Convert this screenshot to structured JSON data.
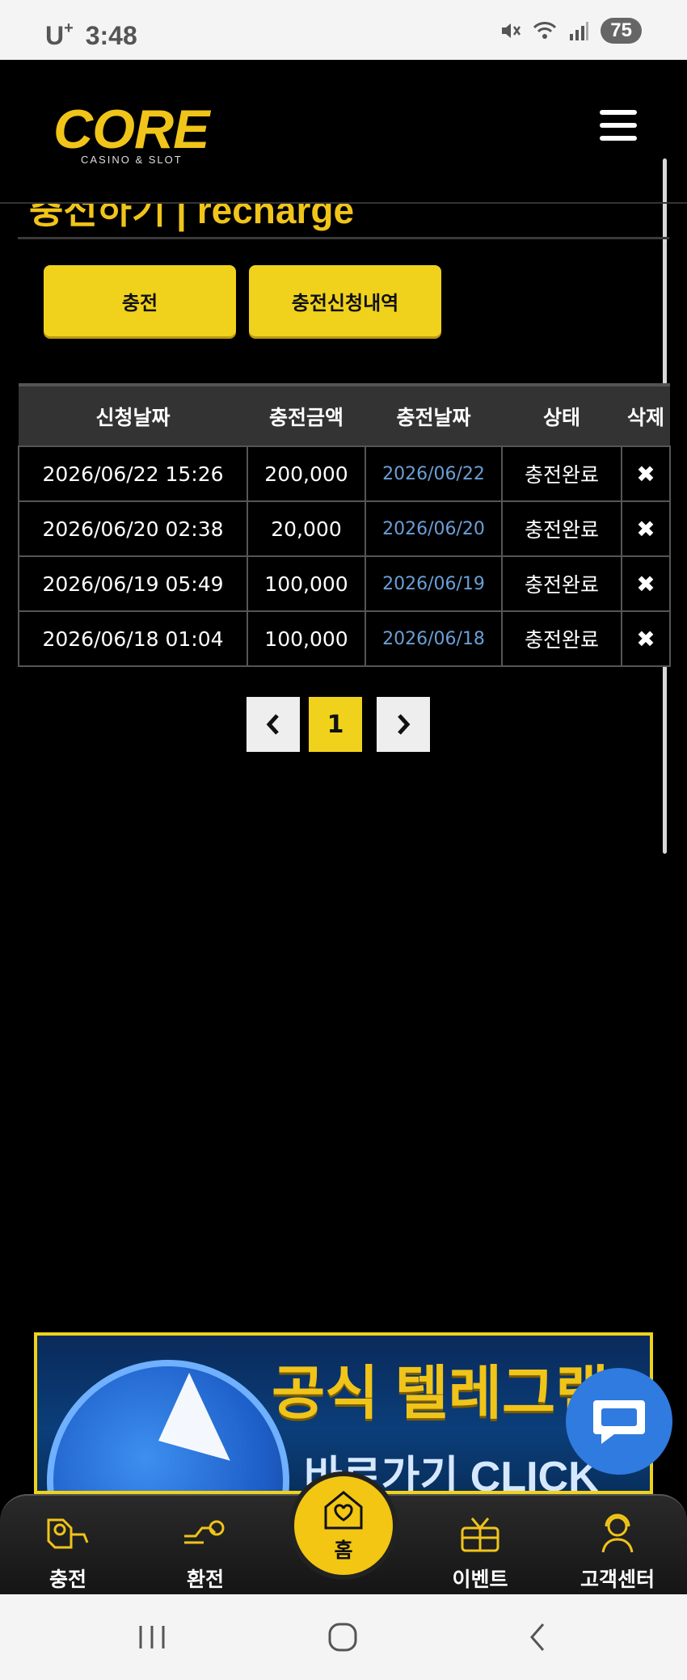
{
  "status_bar": {
    "carrier": "U",
    "carrier_sup": "+",
    "time": "3:48",
    "battery": "75"
  },
  "header": {
    "logo_word": "CORE",
    "logo_sub": "CASINO & SLOT"
  },
  "page_title": "충전하기 | recharge",
  "buttons": {
    "charge": "충전",
    "history": "충전신청내역"
  },
  "table": {
    "headers": [
      "신청날짜",
      "충전금액",
      "충전날짜",
      "상태",
      "삭제"
    ],
    "rows": [
      {
        "requested": "2026/06/22 15:26",
        "amount": "200,000",
        "date": "2026/06/22",
        "status": "충전완료",
        "delete": "✖"
      },
      {
        "requested": "2026/06/20 02:38",
        "amount": "20,000",
        "date": "2026/06/20",
        "status": "충전완료",
        "delete": "✖"
      },
      {
        "requested": "2026/06/19 05:49",
        "amount": "100,000",
        "date": "2026/06/19",
        "status": "충전완료",
        "delete": "✖"
      },
      {
        "requested": "2026/06/18 01:04",
        "amount": "100,000",
        "date": "2026/06/18",
        "status": "충전완료",
        "delete": "✖"
      }
    ]
  },
  "pagination": {
    "prev": "‹",
    "current": "1",
    "next": "›"
  },
  "banner": {
    "line1": "공식 텔레그램",
    "line2": "바로가기 CLICK"
  },
  "bottom_nav": {
    "charge": "충전",
    "exchange": "환전",
    "home": "홈",
    "event": "이벤트",
    "support": "고객센터"
  },
  "colors": {
    "accent": "#f0d21c",
    "link_date": "#6a9fd6",
    "chat": "#2f7be0"
  }
}
